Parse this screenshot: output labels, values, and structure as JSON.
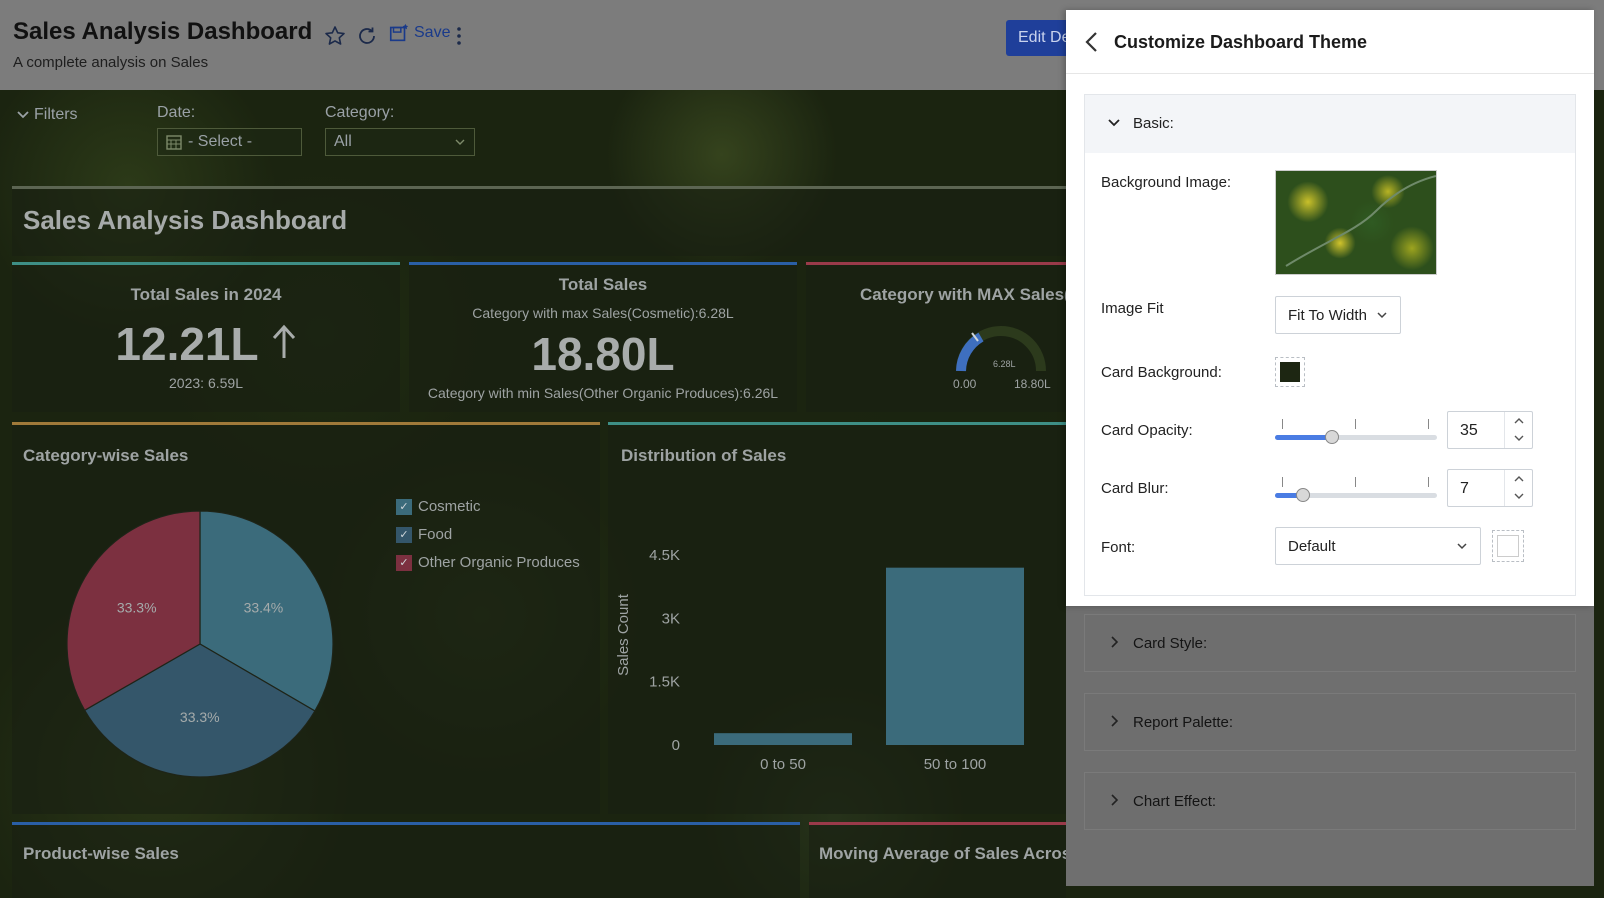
{
  "header": {
    "title": "Sales Analysis Dashboard",
    "subtitle": "A complete analysis on Sales",
    "save_label": "Save",
    "edit_label": "Edit Design"
  },
  "filters": {
    "label": "Filters",
    "date_label": "Date:",
    "date_value": "- Select -",
    "category_label": "Category:",
    "category_value": "All"
  },
  "dashboard": {
    "title": "Sales Analysis Dashboard",
    "kpis": [
      {
        "title": "Total Sales in 2024",
        "value": "12.21L",
        "sub": "2023: 6.59L"
      },
      {
        "title": "Total Sales",
        "top": "Category with max Sales(Cosmetic):6.28L",
        "value": "18.80L",
        "bottom": "Category with min Sales(Other Organic Produces):6.26L"
      },
      {
        "title": "Category with MAX Sales(C",
        "gauge_value": "6.28L",
        "gauge_min": "0.00",
        "gauge_max": "18.80L"
      }
    ],
    "category_card": {
      "title": "Category-wise Sales",
      "legend": [
        "Cosmetic",
        "Food",
        "Other Organic Produces"
      ]
    },
    "distribution_card": {
      "title": "Distribution of Sales"
    },
    "product_card_title": "Product-wise Sales",
    "moving_avg_title": "Moving Average of Sales Across"
  },
  "chart_data": [
    {
      "type": "pie",
      "title": "Category-wise Sales",
      "labels": [
        "Cosmetic",
        "Food",
        "Other Organic Produces"
      ],
      "values": [
        33.4,
        33.3,
        33.3
      ],
      "value_labels": [
        "33.4%",
        "33.3%",
        "33.3%"
      ],
      "colors": [
        "#3b6b7b",
        "#34566a",
        "#7c3040"
      ]
    },
    {
      "type": "bar",
      "title": "Distribution of Sales",
      "categories": [
        "0 to 50",
        "50 to 100"
      ],
      "values": [
        280,
        4200
      ],
      "ylabel": "Sales Count",
      "yticks": [
        "0",
        "1.5K",
        "3K",
        "4.5K"
      ],
      "ylim": [
        0,
        4500
      ],
      "color": "#3b6b7b"
    }
  ],
  "panel": {
    "title": "Customize Dashboard Theme",
    "basic": {
      "label": "Basic:",
      "background_image_label": "Background Image:",
      "image_fit_label": "Image Fit",
      "image_fit_value": "Fit To Width",
      "card_background_label": "Card Background:",
      "card_background_color": "#1d2612",
      "card_opacity_label": "Card Opacity:",
      "card_opacity_value": "35",
      "card_opacity_level": 0.35,
      "card_blur_label": "Card Blur:",
      "card_blur_value": "7",
      "card_blur_level": 0.17,
      "font_label": "Font:",
      "font_value": "Default"
    },
    "sections": [
      "Card Style:",
      "Report Palette:",
      "Chart Effect:"
    ]
  },
  "colors": {
    "accent_blue": "#4a7ce3",
    "teal_bar": "#3b6b7b",
    "maroon": "#7c3040"
  }
}
